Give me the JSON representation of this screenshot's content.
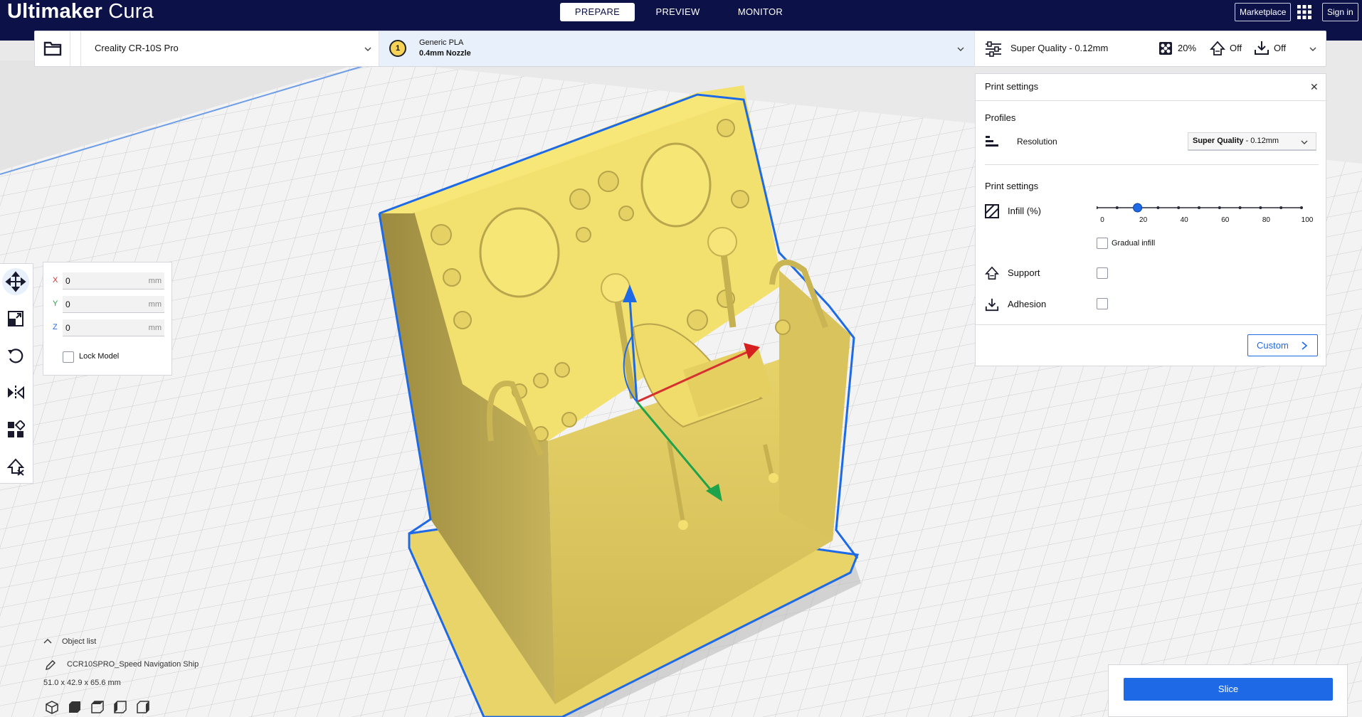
{
  "app": {
    "logo_bold": "Ultimaker",
    "logo_light": "Cura"
  },
  "stages": [
    {
      "label": "PREPARE",
      "active": true
    },
    {
      "label": "PREVIEW",
      "active": false
    },
    {
      "label": "MONITOR",
      "active": false
    }
  ],
  "topbar": {
    "marketplace": "Marketplace",
    "signin": "Sign in"
  },
  "header": {
    "printer": "Creality CR-10S Pro",
    "extruder_number": "1",
    "material": "Generic PLA",
    "nozzle": "0.4mm Nozzle",
    "quality": "Super Quality - 0.12mm",
    "infill": "20%",
    "support": "Off",
    "adhesion": "Off"
  },
  "print_settings": {
    "title": "Print settings",
    "profiles_label": "Profiles",
    "resolution_label": "Resolution",
    "resolution_value_bold": "Super Quality",
    "resolution_value_rest": " - 0.12mm",
    "section_label": "Print settings",
    "infill_label": "Infill (%)",
    "infill_value": 20,
    "infill_ticks": [
      "0",
      "20",
      "40",
      "60",
      "80",
      "100"
    ],
    "gradual_infill_label": "Gradual infill",
    "gradual_infill_checked": false,
    "support_label": "Support",
    "support_checked": false,
    "adhesion_label": "Adhesion",
    "adhesion_checked": false,
    "custom_button": "Custom"
  },
  "translate": {
    "x_label": "X",
    "x_value": "0",
    "y_label": "Y",
    "y_value": "0",
    "z_label": "Z",
    "z_value": "0",
    "unit": "mm",
    "lock_model_label": "Lock Model",
    "lock_model_checked": false
  },
  "object_list": {
    "title": "Object list",
    "object_name": "CCR10SPRO_Speed Navigation Ship",
    "dimensions": "51.0 x 42.9 x 65.6 mm"
  },
  "slice_button": "Slice",
  "colors": {
    "nav_bg": "#0c1147",
    "accent": "#1e6ae6",
    "model_yellow": "#f6e56b",
    "model_shade": "#8a7a3c",
    "selection_outline": "#1e6ae6"
  }
}
